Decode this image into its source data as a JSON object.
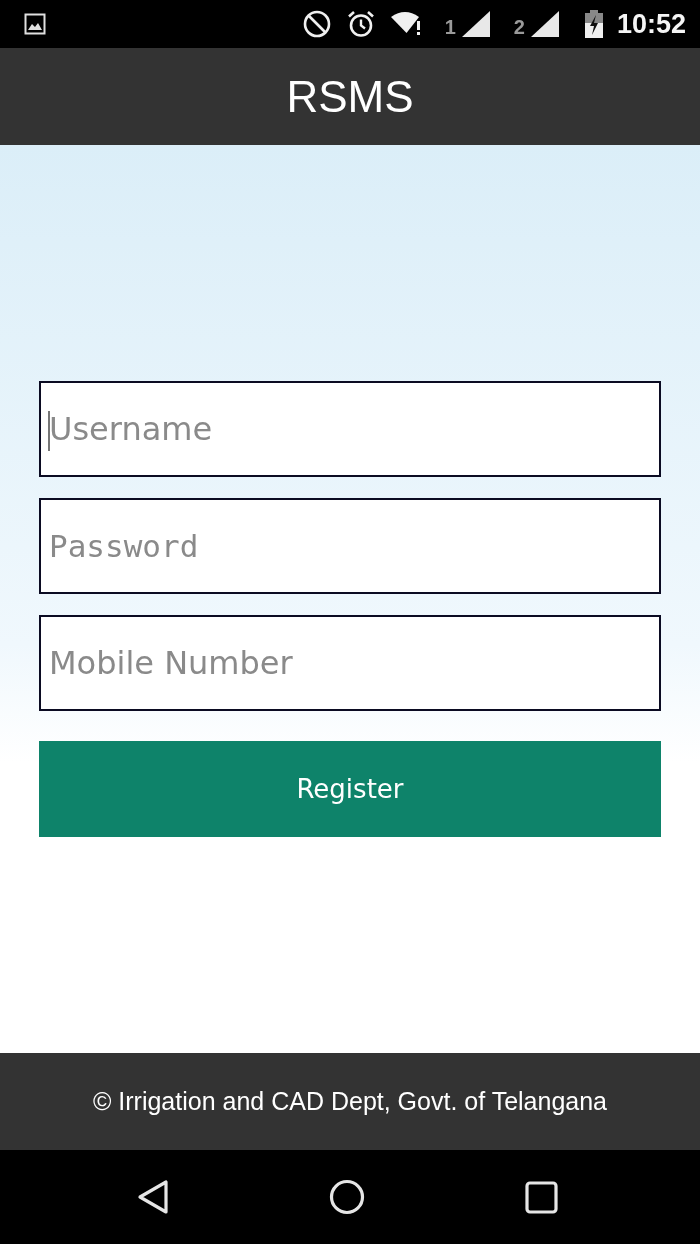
{
  "status_bar": {
    "signals": [
      {
        "label": "1"
      },
      {
        "label": "2"
      }
    ],
    "time": "10:52"
  },
  "app_bar": {
    "title": "RSMS"
  },
  "form": {
    "fields": [
      {
        "kind": "text",
        "placeholder": "Username",
        "focused": true
      },
      {
        "kind": "password",
        "placeholder": "Password",
        "focused": false
      },
      {
        "kind": "phone",
        "placeholder": "Mobile Number",
        "focused": false
      }
    ],
    "submit": {
      "label": "Register"
    }
  },
  "footer": {
    "text": "© Irrigation and CAD Dept, Govt. of Telangana"
  }
}
